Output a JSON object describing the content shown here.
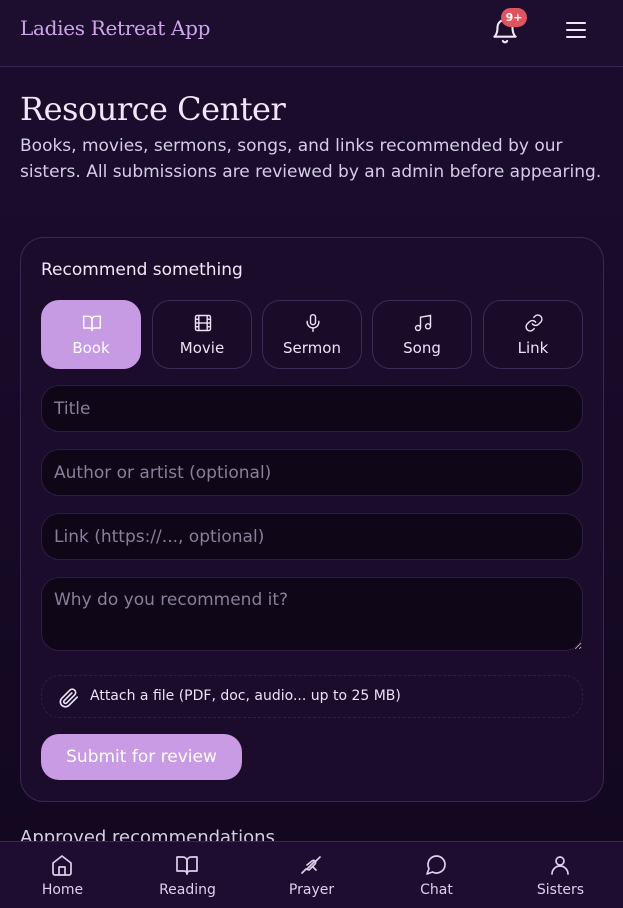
{
  "header": {
    "app_title": "Ladies Retreat App",
    "notification_badge": "9+"
  },
  "page": {
    "title": "Resource Center",
    "description": "Books, movies, sermons, songs, and links recommended by our sisters. All submissions are reviewed by an admin before appearing."
  },
  "form": {
    "heading": "Recommend something",
    "types": [
      {
        "label": "Book",
        "icon": "book-icon",
        "selected": true
      },
      {
        "label": "Movie",
        "icon": "film-icon",
        "selected": false
      },
      {
        "label": "Sermon",
        "icon": "microphone-icon",
        "selected": false
      },
      {
        "label": "Song",
        "icon": "music-note-icon",
        "selected": false
      },
      {
        "label": "Link",
        "icon": "link-icon",
        "selected": false
      }
    ],
    "title_placeholder": "Title",
    "author_placeholder": "Author or artist (optional)",
    "link_placeholder": "Link (https://..., optional)",
    "why_placeholder": "Why do you recommend it?",
    "attach_label": "Attach a file (PDF, doc, audio... up to 25 MB)",
    "submit_label": "Submit for review"
  },
  "approved_heading": "Approved recommendations",
  "nav": {
    "items": [
      {
        "label": "Home",
        "icon": "home-icon"
      },
      {
        "label": "Reading",
        "icon": "book-icon"
      },
      {
        "label": "Prayer",
        "icon": "praying-hands-icon"
      },
      {
        "label": "Chat",
        "icon": "chat-bubble-icon"
      },
      {
        "label": "Sisters",
        "icon": "user-icon"
      }
    ]
  },
  "colors": {
    "background": "#1c0d2e",
    "accent": "#c79ae4",
    "title_accent": "#cda6ea",
    "badge": "#e0545e"
  }
}
